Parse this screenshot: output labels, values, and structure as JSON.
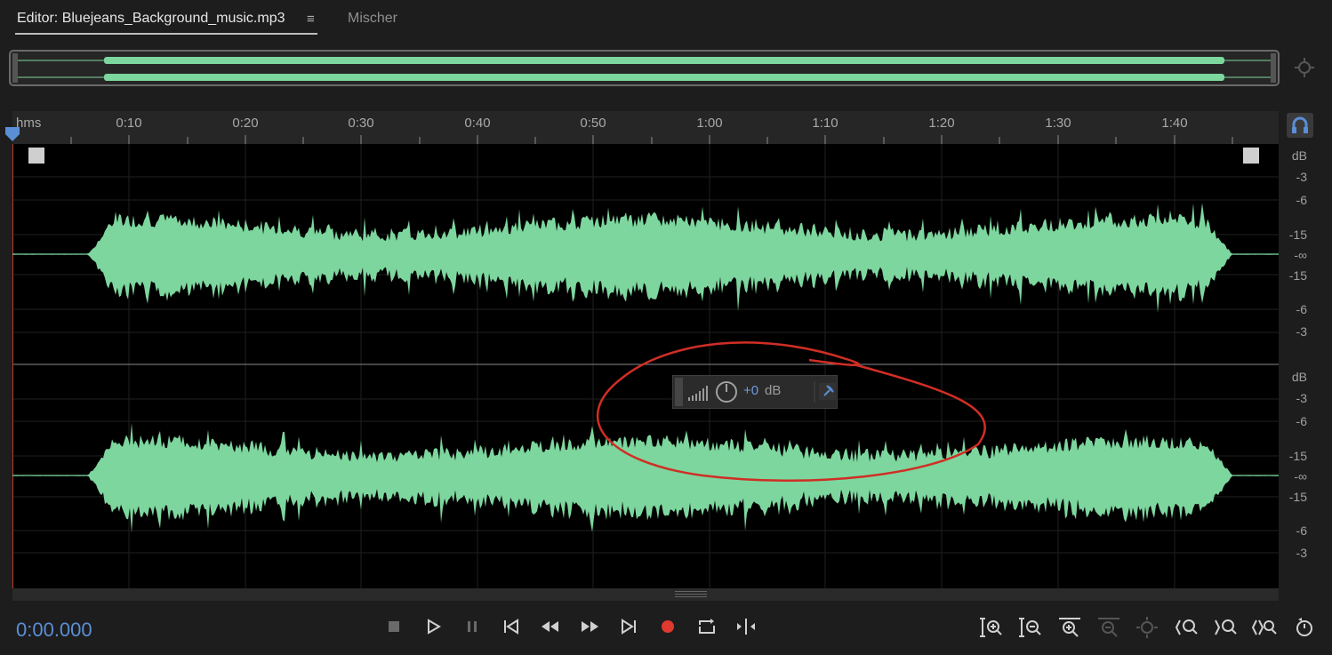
{
  "tabs": {
    "editor_label": "Editor: Bluejeans_Background_music.mp3",
    "menu_glyph": "≡",
    "mixer_label": "Mischer"
  },
  "ruler": {
    "unit_label": "hms",
    "ticks": [
      "0:10",
      "0:20",
      "0:30",
      "0:40",
      "0:50",
      "1:00",
      "1:10",
      "1:20",
      "1:30",
      "1:40"
    ]
  },
  "db_scale": {
    "channel_top": [
      "dB",
      "-3",
      "-6",
      "-15",
      "-∞",
      "-15",
      "-6",
      "-3"
    ],
    "channel_bottom": [
      "dB",
      "-3",
      "-6",
      "-15",
      "-∞",
      "-15",
      "-6",
      "-3"
    ]
  },
  "hud": {
    "value": "+0",
    "unit": "dB"
  },
  "time_display": "0:00.000",
  "transport": [
    "stop-icon",
    "play-icon",
    "pause-icon",
    "skip-to-start-icon",
    "rewind-icon",
    "fast-forward-icon",
    "skip-to-end-icon",
    "record-icon",
    "loop-icon",
    "skip-selection-icon"
  ],
  "zoom_tools": [
    "zoom-in-amplitude-icon",
    "zoom-out-amplitude-icon",
    "zoom-in-time-icon",
    "zoom-out-full-icon",
    "zoom-to-selection-icon",
    "zoom-in-left-icon",
    "zoom-in-right-icon",
    "zoom-out-both-icon",
    "zoom-reset-icon"
  ],
  "colors": {
    "waveform": "#7dd69e",
    "accent_blue": "#5a8fd6",
    "record_red": "#e0392f",
    "annotation_red": "#d02e25"
  }
}
